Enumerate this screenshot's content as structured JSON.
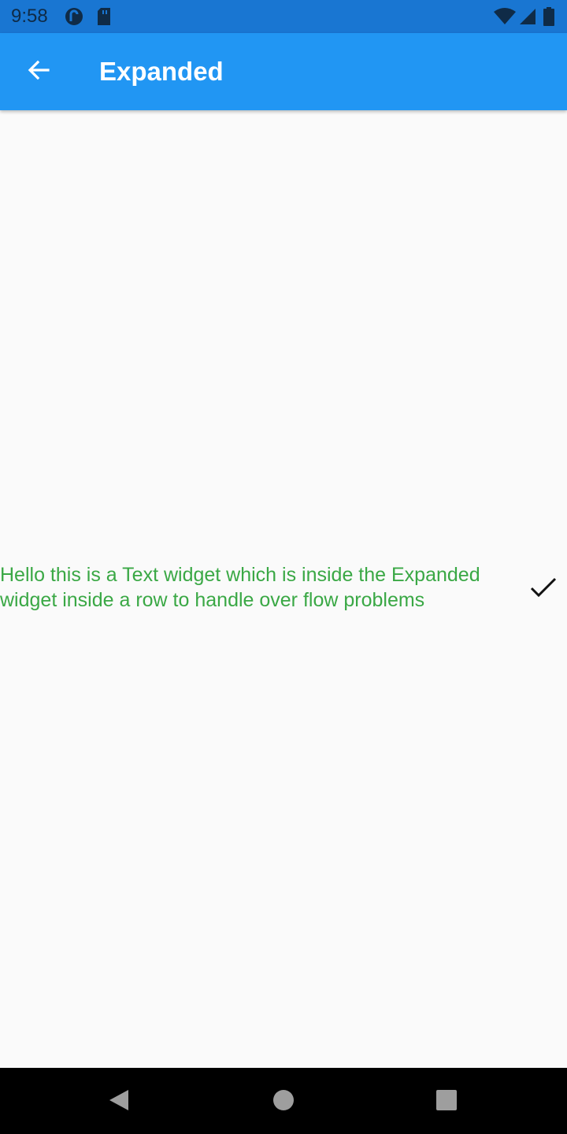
{
  "status_bar": {
    "time": "9:58",
    "icons": [
      "pocket-casts-icon",
      "sd-card-icon",
      "wifi-icon",
      "cell-signal-icon",
      "battery-icon"
    ],
    "background_color": "#1976d2"
  },
  "app_bar": {
    "title": "Expanded",
    "back_icon": "arrow-left-icon",
    "background_color": "#2196f3"
  },
  "content": {
    "text": "Hello this is a Text widget which is inside the Expanded widget inside a row to handle over flow problems",
    "text_color": "#3aa845",
    "trailing_icon": "check-icon"
  },
  "nav_bar": {
    "buttons": [
      "back-triangle-icon",
      "home-circle-icon",
      "recents-square-icon"
    ]
  }
}
